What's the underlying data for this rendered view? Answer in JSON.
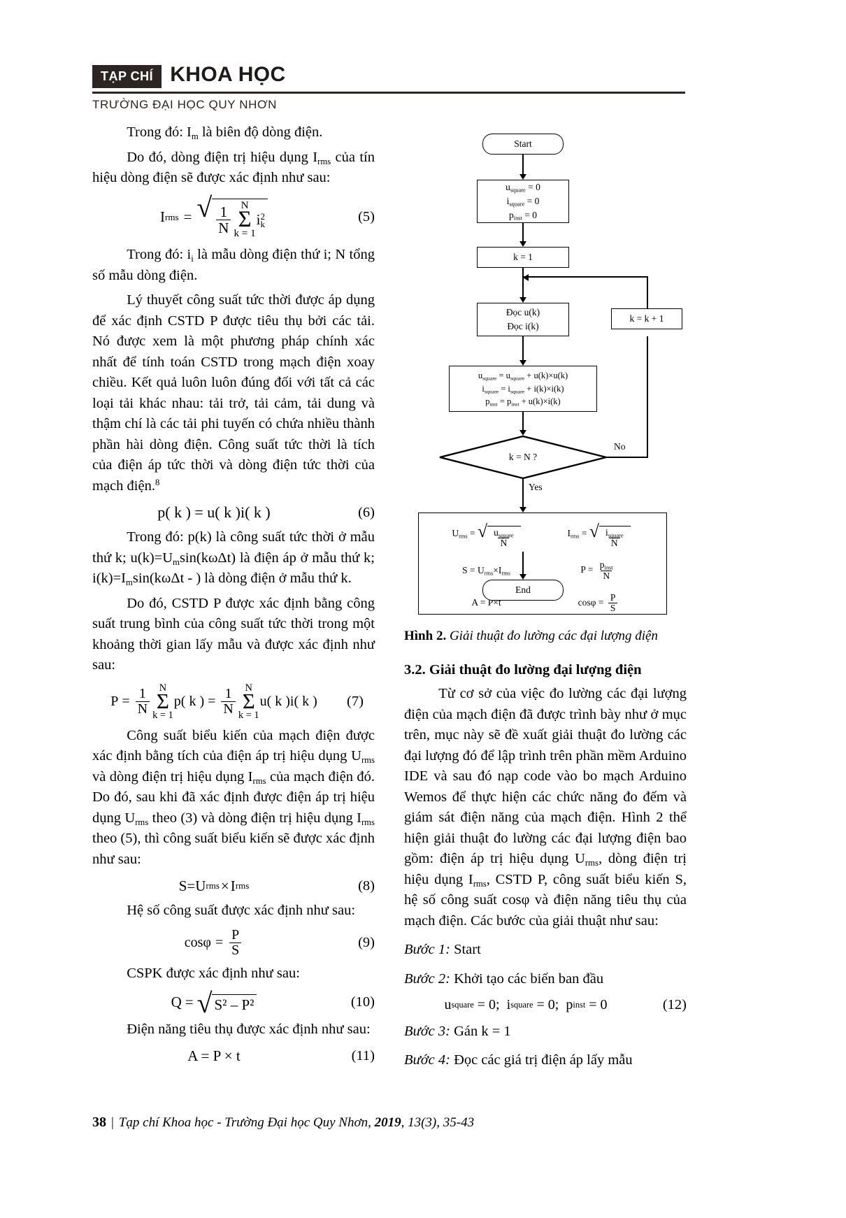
{
  "masthead": {
    "badge": "TẠP CHÍ",
    "title": "KHOA HỌC",
    "subtitle": "TRƯỜNG ĐẠI HỌC QUY NHƠN"
  },
  "left_column": {
    "p1": "Trong đó: I",
    "p1_sub": "m",
    "p1_rest": " là biên độ dòng điện.",
    "p2_a": "Do đó, dòng điện trị hiệu dụng I",
    "p2_sub": "rms",
    "p2_b": " của tín hiệu dòng điện sẽ được xác định như sau:",
    "eq5": {
      "lhs": "I",
      "lhs_sub": "rms",
      "eq": "=",
      "one": "1",
      "N": "N",
      "sigma_top": "N",
      "sigma_bot": "k = 1",
      "term": "i",
      "term_sub": "k",
      "term_sup": "2",
      "num": "(5)"
    },
    "p3_a": "Trong đó: i",
    "p3_sub": "i",
    "p3_b": " là mẫu dòng điện thứ i; N tổng số mẫu dòng điện.",
    "p4": "Lý thuyết công suất tức thời được áp dụng để xác định CSTD P được tiêu thụ bởi các tải. Nó được xem là một phương pháp chính xác nhất để tính toán CSTD trong mạch điện xoay chiều. Kết quả luôn luôn đúng đối với tất cả các loại tải khác nhau: tải trở, tải cảm, tải dung và thậm chí là các tải phi tuyến có chứa nhiều thành phần hài dòng điện. Công suất tức thời là tích của điện áp tức thời và dòng điện tức thời của mạch điện.",
    "p4_sup": "8",
    "eq6": {
      "expr": "p( k ) = u( k )i( k )",
      "num": "(6)"
    },
    "p5_a": "Trong đó: p(k) là công suất tức thời ở mẫu thứ k; u(k)=U",
    "p5_sub1": "m",
    "p5_b": "sin(kωΔt) là điện áp ở mẫu thứ k; i(k)=I",
    "p5_sub2": "m",
    "p5_c": "sin(kωΔt - ) là dòng điện ở mẫu thứ k.",
    "p6": "Do đó, CSTD P được xác định bằng công suất trung bình của công suất tức thời trong một khoảng thời gian lấy mẫu và được xác định như sau:",
    "eq7": {
      "lhs": "P",
      "eq1": "=",
      "one": "1",
      "N": "N",
      "sigma_top": "N",
      "sigma_bot": "k = 1",
      "mid": "p( k )",
      "eq2": "=",
      "tail": "u( k )i( k )",
      "num": "(7)"
    },
    "p7_a": "Công suất biểu kiến của mạch điện được xác định bằng tích của điện áp trị hiệu dụng U",
    "p7_sub1": "rms",
    "p7_b": " và dòng điện trị hiệu dụng I",
    "p7_sub2": "rms",
    "p7_c": " của mạch điện đó. Do đó, sau khi đã xác định được điện áp trị hiệu dụng U",
    "p7_sub3": "rms",
    "p7_d": " theo (3) và dòng điện trị hiệu dụng I",
    "p7_sub4": "rms",
    "p7_e": " theo (5), thì công suất biểu kiến sẽ được xác định như sau:",
    "eq8": {
      "lhs": "S",
      "eq": "=",
      "u": "U",
      "u_sub": "rms",
      "times": "×",
      "i": "I",
      "i_sub": "rms",
      "num": "(8)"
    },
    "p8": "Hệ số công suất được xác định như sau:",
    "eq9": {
      "lhs": "cosφ",
      "eq": "=",
      "num_top": "P",
      "num_bot": "S",
      "num": "(9)"
    },
    "p9": "CSPK được xác định như sau:",
    "eq10": {
      "lhs": "Q",
      "eq": "=",
      "rad": "S² – P²",
      "num": "(10)"
    },
    "p10": "Điện năng tiêu thụ được xác định như sau:",
    "eq11": {
      "expr": "A = P × t",
      "num": "(11)"
    }
  },
  "flowchart": {
    "start": "Start",
    "init": [
      {
        "var": "u",
        "sub": "square",
        "val": "= 0"
      },
      {
        "var": "i",
        "sub": "square",
        "val": "= 0"
      },
      {
        "var": "p",
        "sub": "inst",
        "val": "= 0"
      }
    ],
    "k_init": "k = 1",
    "read": [
      "Đọc u(k)",
      "Đọc i(k)"
    ],
    "accumulate": [
      {
        "lhs": "u",
        "lhs_sub": "square",
        "eq": "=",
        "rhs": "u",
        "rhs_sub": "square",
        "plus": "+ u(k)×u(k)"
      },
      {
        "lhs": "i",
        "lhs_sub": "square",
        "eq": "=",
        "rhs": "i",
        "rhs_sub": "square",
        "plus": "+ i(k)×i(k)"
      },
      {
        "lhs": "p",
        "lhs_sub": "inst",
        "eq": "=",
        "rhs": "p",
        "rhs_sub": "inst",
        "plus": "+ u(k)×i(k)"
      }
    ],
    "decision": "k = N ?",
    "no_label": "No",
    "yes_label": "Yes",
    "increment": "k = k + 1",
    "calc": {
      "urms_lhs": "U",
      "urms_sub": "rms",
      "urms_num": "u",
      "urms_num_sub": "square",
      "urms_den": "N",
      "irms_lhs": "I",
      "irms_sub": "rms",
      "irms_num": "i",
      "irms_num_sub": "square",
      "irms_den": "N",
      "s_expr_lhs": "S",
      "s_u": "U",
      "s_u_sub": "rms",
      "s_times": "×",
      "s_i": "I",
      "s_i_sub": "rms",
      "p_lhs": "P",
      "p_num": "p",
      "p_num_sub": "inst",
      "p_den": "N",
      "a_expr": "A = P×t",
      "cos_lhs": "cosφ",
      "cos_num": "P",
      "cos_den": "S"
    },
    "end": "End"
  },
  "right_column": {
    "figure_caption_label": "Hình 2.",
    "figure_caption_text": " Giải thuật đo lường các đại lượng điện",
    "section_heading": "3.2. Giải thuật đo lường đại lượng điện",
    "p1_a": "Từ cơ sở của việc đo lường các đại lượng điện của mạch điện đã được trình bày như ở mục trên, mục này sẽ đề xuất giải thuật đo lường các đại lượng đó để lập trình trên phần mềm Arduino IDE và sau đó nạp code vào bo mạch Arduino Wemos để thực hiện các chức năng đo đếm và giám sát điện năng của mạch điện. Hình 2 thể hiện giải thuật đo lường các đại lượng điện bao gồm: điện áp trị hiệu dụng U",
    "p1_sub1": "rms",
    "p1_b": ", dòng điện trị hiệu dụng I",
    "p1_sub2": "rms",
    "p1_c": ", CSTD P, công suất biểu kiến S, hệ số công suất cosφ và điện năng tiêu thụ của mạch điện. Các bước của giải thuật như sau:",
    "step1_label": "Bước 1:",
    "step1_text": " Start",
    "step2_label": "Bước 2:",
    "step2_text": " Khởi tạo các biến ban đầu",
    "eq12": {
      "u": "u",
      "u_sub": "square",
      "u_val": "= 0;",
      "i": "i",
      "i_sub": "square",
      "i_val": "= 0;",
      "p": "p",
      "p_sub": "inst",
      "p_val": "= 0",
      "num": "(12)"
    },
    "step3_label": "Bước 3:",
    "step3_text": " Gán k = 1",
    "step4_label": "Bước 4:",
    "step4_text": " Đọc các giá trị điện áp lấy mẫu"
  },
  "footer": {
    "page": "38",
    "sep": "|",
    "text_a": "Tạp chí Khoa học - Trường Đại học Quy Nhơn, ",
    "year": "2019",
    "text_b": ", 13(3), 35-43"
  }
}
